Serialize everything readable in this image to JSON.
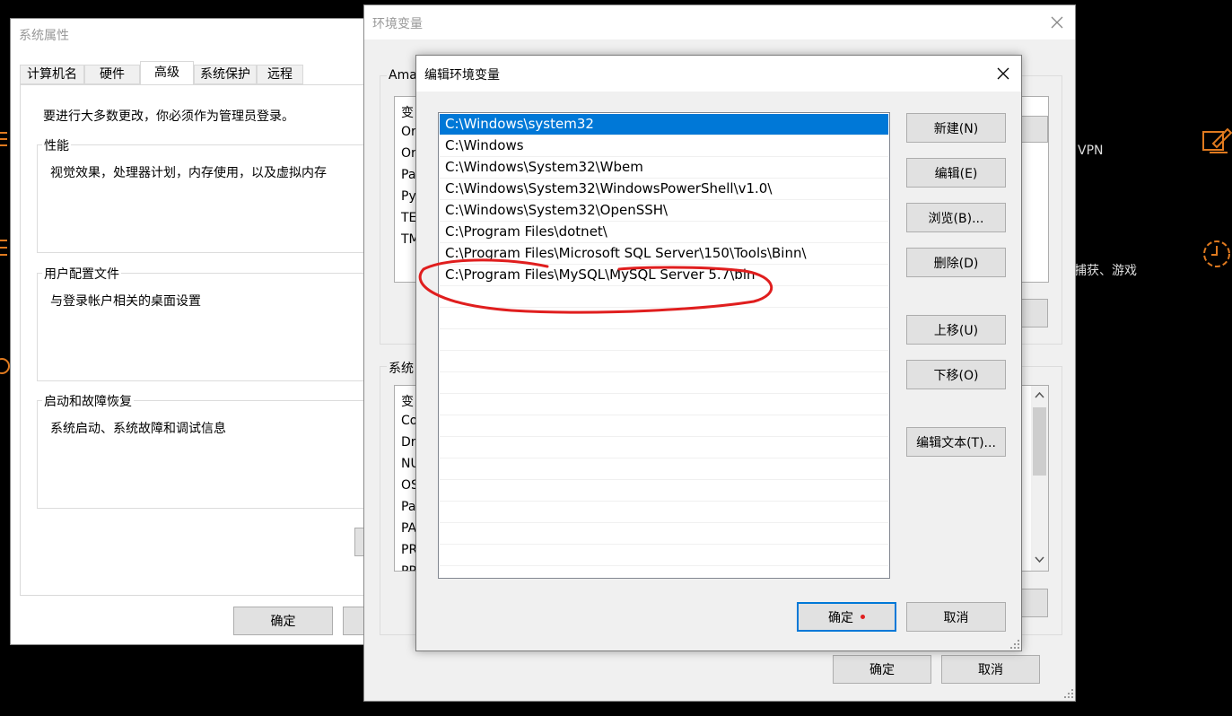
{
  "background": {
    "vpn_label": "VPN",
    "bottom_text": "捕获、游戏",
    "accent_color": "#e07a1f"
  },
  "sys_props": {
    "title": "系统属性",
    "tabs": [
      "计算机名",
      "硬件",
      "高级",
      "系统保护",
      "远程"
    ],
    "active_tab": "高级",
    "admin_notice": "要进行大多数更改，你必须作为管理员登录。",
    "perf_group": "性能",
    "perf_desc": "视觉效果，处理器计划，内存使用，以及虚拟内存",
    "profile_group": "用户配置文件",
    "profile_desc": "与登录帐户相关的桌面设置",
    "startup_group": "启动和故障恢复",
    "startup_desc": "系统启动、系统故障和调试信息",
    "ok_label": "确定"
  },
  "env_vars": {
    "title": "环境变量",
    "user_group": "Ama",
    "user_col_header": "变",
    "user_rows": [
      "Or",
      "Or",
      "Pa",
      "Py",
      "TE",
      "TM"
    ],
    "sys_group": "系统",
    "sys_col_header": "变",
    "sys_rows": [
      "Co",
      "Dr",
      "NU",
      "OS",
      "Pa",
      "PA",
      "PR",
      "PR"
    ],
    "ok_label": "确定",
    "cancel_label": "取消"
  },
  "edit_dialog": {
    "title": "编辑环境变量",
    "paths": [
      "C:\\Windows\\system32",
      "C:\\Windows",
      "C:\\Windows\\System32\\Wbem",
      "C:\\Windows\\System32\\WindowsPowerShell\\v1.0\\",
      "C:\\Windows\\System32\\OpenSSH\\",
      "C:\\Program Files\\dotnet\\",
      "C:\\Program Files\\Microsoft SQL Server\\150\\Tools\\Binn\\",
      "C:\\Program Files\\MySQL\\MySQL Server 5.7\\bin"
    ],
    "selected_index": 0,
    "buttons": {
      "new": "新建(N)",
      "edit": "编辑(E)",
      "browse": "浏览(B)...",
      "delete": "删除(D)",
      "move_up": "上移(U)",
      "move_down": "下移(O)",
      "edit_text": "编辑文本(T)...",
      "ok": "确定",
      "cancel": "取消"
    }
  }
}
